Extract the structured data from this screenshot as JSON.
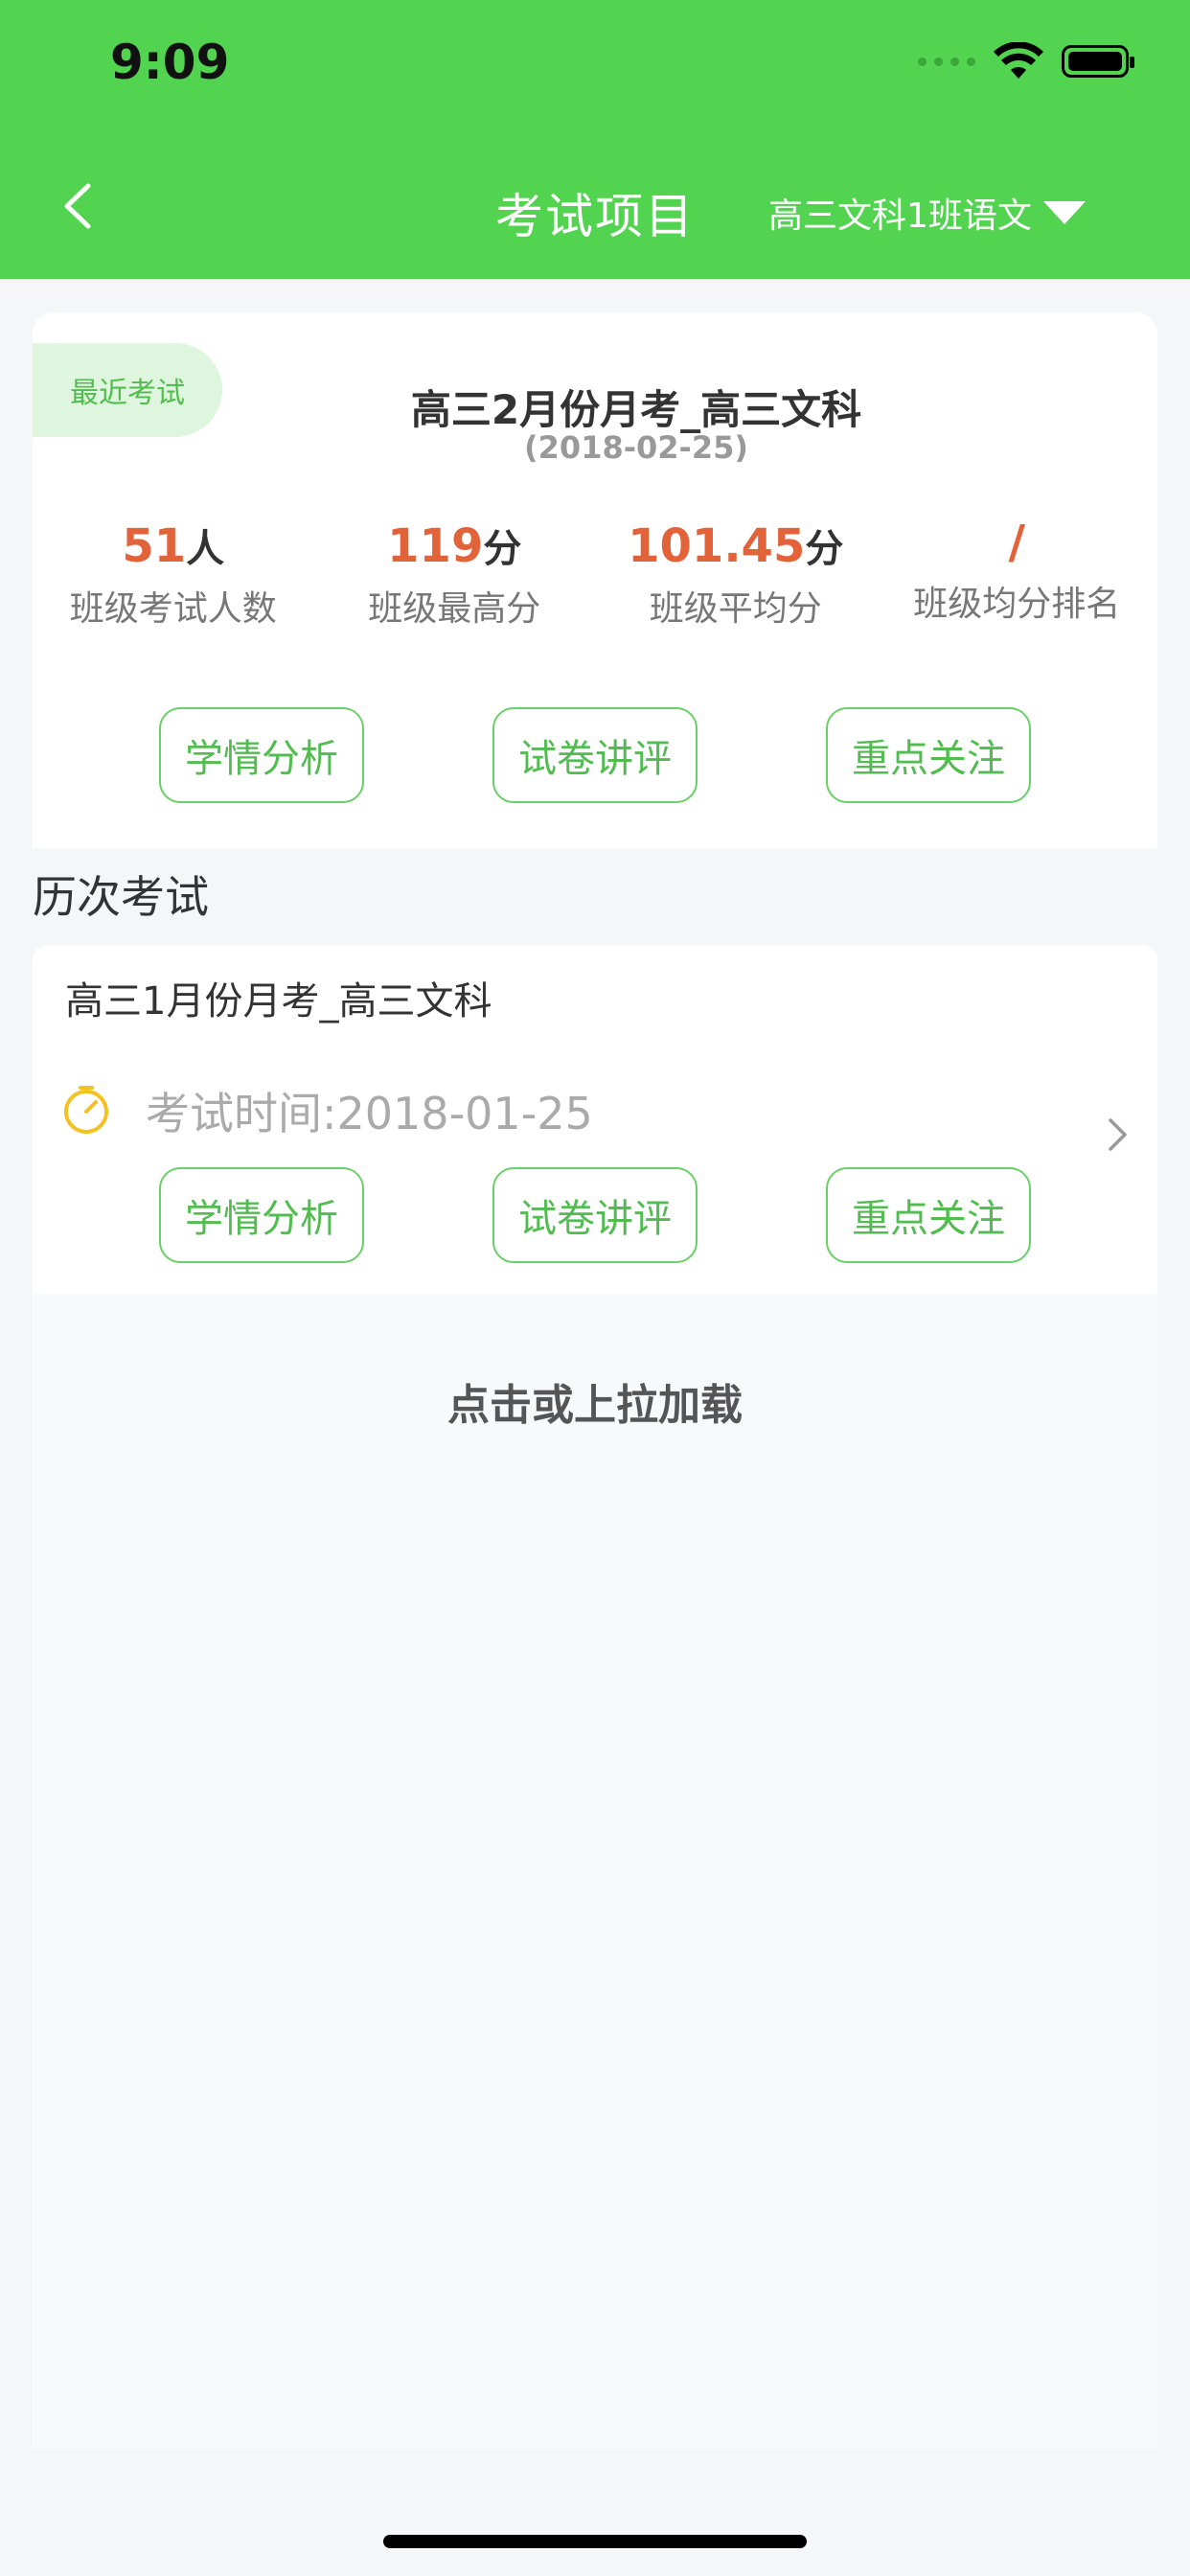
{
  "status_bar": {
    "time": "9:09"
  },
  "nav": {
    "title": "考试项目",
    "class_selector": "高三文科1班语文"
  },
  "latest_exam": {
    "badge": "最近考试",
    "title": "高三2月份月考_高三文科",
    "date": "(2018-02-25)",
    "stats": [
      {
        "value": "51",
        "unit": "人",
        "label": "班级考试人数"
      },
      {
        "value": "119",
        "unit": "分",
        "label": "班级最高分"
      },
      {
        "value": "101.45",
        "unit": "分",
        "label": "班级平均分"
      },
      {
        "value": "/",
        "unit": "",
        "label": "班级均分排名"
      }
    ],
    "buttons": [
      "学情分析",
      "试卷讲评",
      "重点关注"
    ]
  },
  "history": {
    "section_title": "历次考试",
    "items": [
      {
        "title": "高三1月份月考_高三文科",
        "date_text": "考试时间:2018-01-25",
        "buttons": [
          "学情分析",
          "试卷讲评",
          "重点关注"
        ]
      }
    ]
  },
  "load_more": "点击或上拉加载",
  "colors": {
    "header_green": "#52d450",
    "accent_green": "#52bc50",
    "stat_orange": "#e2623a",
    "clock_yellow": "#f3c122"
  }
}
